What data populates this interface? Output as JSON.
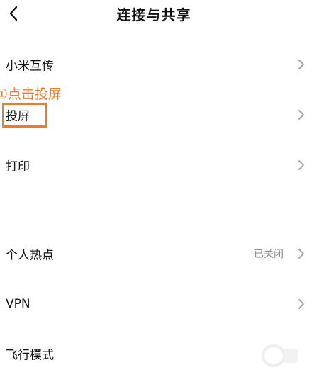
{
  "header": {
    "title": "连接与共享"
  },
  "annotation": {
    "text": "①点击投屏",
    "color": "#ee7a2c"
  },
  "settings": {
    "items": [
      {
        "label": "小米互传",
        "icon": "chevron-right-icon"
      },
      {
        "label": "投屏",
        "icon": "chevron-right-icon"
      },
      {
        "label": "打印",
        "icon": "chevron-right-icon"
      },
      {
        "label": "个人热点",
        "value": "已关闭",
        "icon": "chevron-right-icon"
      },
      {
        "label": "VPN",
        "icon": "chevron-right-icon"
      },
      {
        "label": "飞行模式"
      }
    ]
  },
  "icons": {
    "back": "back-arrow-icon",
    "watermark": "watermark-logo-icon"
  },
  "colors": {
    "accent": "#ee7a2c",
    "text": "#111111",
    "secondary_text": "#8a8a8a",
    "chevron": "#9a9a9a"
  }
}
